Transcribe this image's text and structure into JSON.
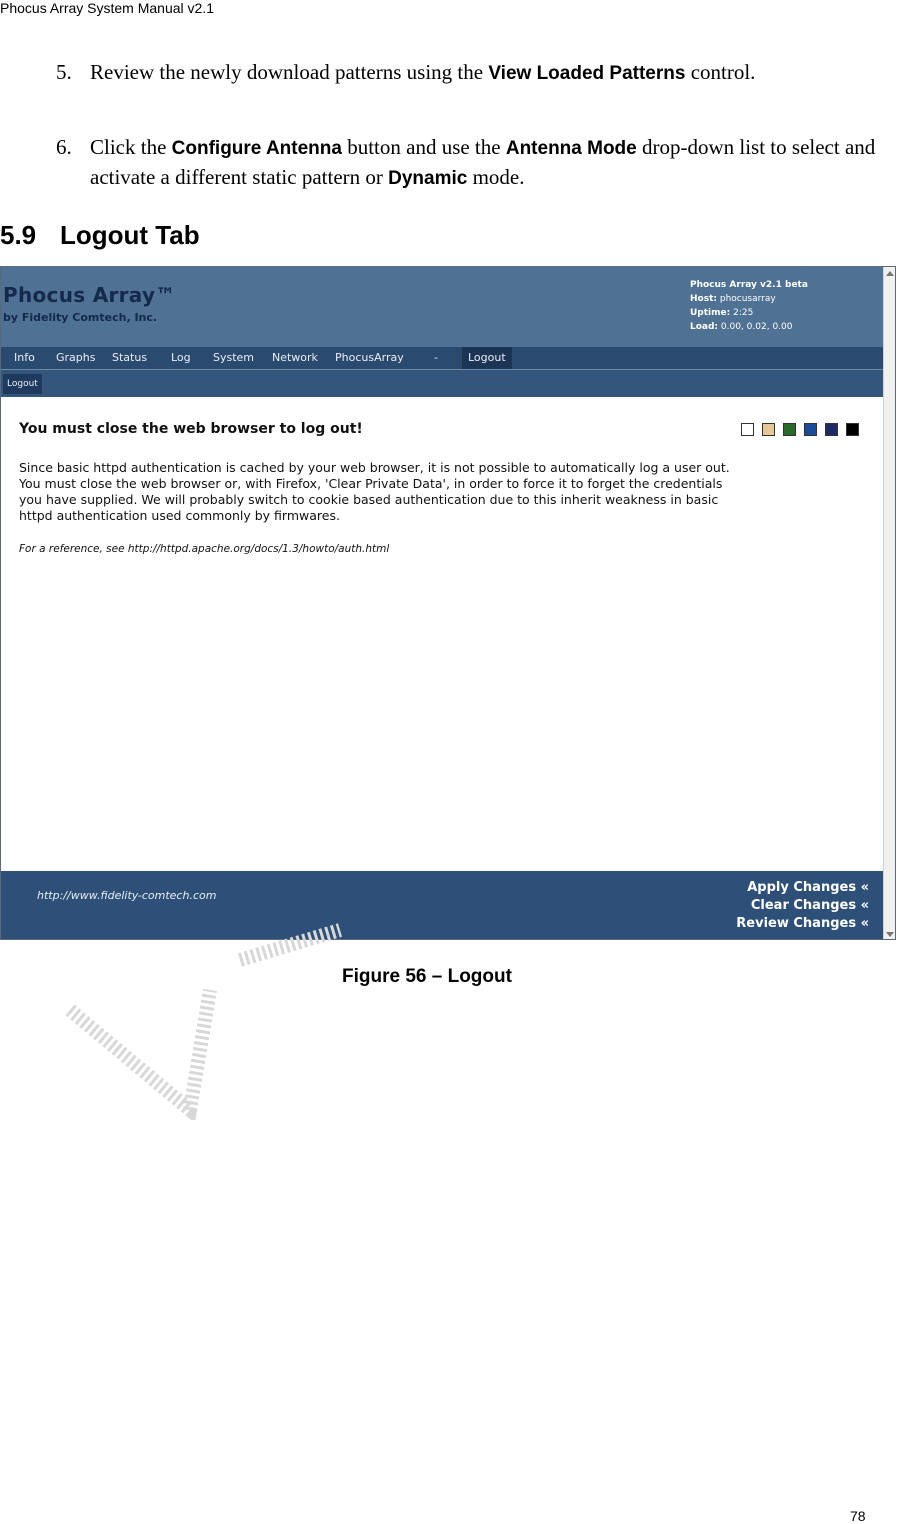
{
  "doc_header": "Phocus Array System Manual v2.1",
  "steps": [
    {
      "num": "5.",
      "t1": "Review the newly download patterns using the ",
      "b1": "View Loaded Patterns",
      "t2": " control."
    },
    {
      "num": "6.",
      "t1": "Click the ",
      "b1": "Configure Antenna",
      "t2": " button and use the ",
      "b2": "Antenna Mode",
      "t3": " drop-down list to select and activate a different static pattern or ",
      "b3": "Dynamic",
      "t4": " mode."
    }
  ],
  "section": {
    "num": "5.9",
    "title": "Logout Tab"
  },
  "screenshot": {
    "brand_title": "Phocus Array™",
    "brand_sub": "by Fidelity Comtech, Inc.",
    "sysinfo": {
      "version": "Phocus Array v2.1 beta",
      "host_label": "Host:",
      "host": "phocusarray",
      "uptime_label": "Uptime:",
      "uptime": "2:25",
      "load_label": "Load:",
      "load": "0.00, 0.02, 0.00"
    },
    "nav": [
      "Info",
      "Graphs",
      "Status",
      "Log",
      "System",
      "Network",
      "PhocusArray",
      "-",
      "Logout"
    ],
    "subtab": "Logout",
    "heading": "You must close the web browser to log out!",
    "swatch_colors": [
      "#ffffff",
      "#e6c898",
      "#2a6a2a",
      "#1b4a96",
      "#1c2a66",
      "#000000"
    ],
    "paragraph": [
      "Since basic httpd authentication is cached by your web browser, it is not possible to automatically log a user out.",
      "You must close the web browser or, with Firefox, 'Clear Private Data', in order to force it to forget the credentials",
      "you have supplied. We will probably switch to cookie based authentication due to this inherit weakness in basic",
      "httpd authentication used commonly by firmwares."
    ],
    "reference": "For a reference, see http://httpd.apache.org/docs/1.3/howto/auth.html",
    "footer_url": "http://www.fidelity-comtech.com",
    "footer_links": [
      "Apply Changes «",
      "Clear Changes «",
      "Review Changes «"
    ]
  },
  "caption": "Figure 56 – Logout",
  "page_number": "78"
}
